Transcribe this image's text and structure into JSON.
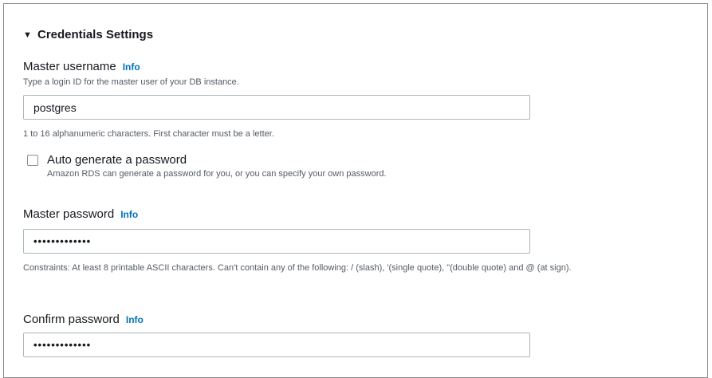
{
  "section": {
    "title": "Credentials Settings",
    "caret_icon": "caret-down-icon"
  },
  "username": {
    "label": "Master username",
    "info": "Info",
    "description": "Type a login ID for the master user of your DB instance.",
    "value": "postgres",
    "constraint": "1 to 16 alphanumeric characters. First character must be a letter."
  },
  "auto_generate": {
    "label": "Auto generate a password",
    "description": "Amazon RDS can generate a password for you, or you can specify your own password.",
    "checked": false
  },
  "password": {
    "label": "Master password",
    "info": "Info",
    "value": "•••••••••••••",
    "constraint": "Constraints: At least 8 printable ASCII characters. Can't contain any of the following: / (slash), '(single quote), \"(double quote) and @ (at sign)."
  },
  "confirm": {
    "label": "Confirm password",
    "info": "Info",
    "value": "•••••••••••••"
  },
  "colors": {
    "link": "#0073bb",
    "text": "#16191f",
    "secondary_text": "#545b64",
    "input_border": "#aab7b8"
  }
}
